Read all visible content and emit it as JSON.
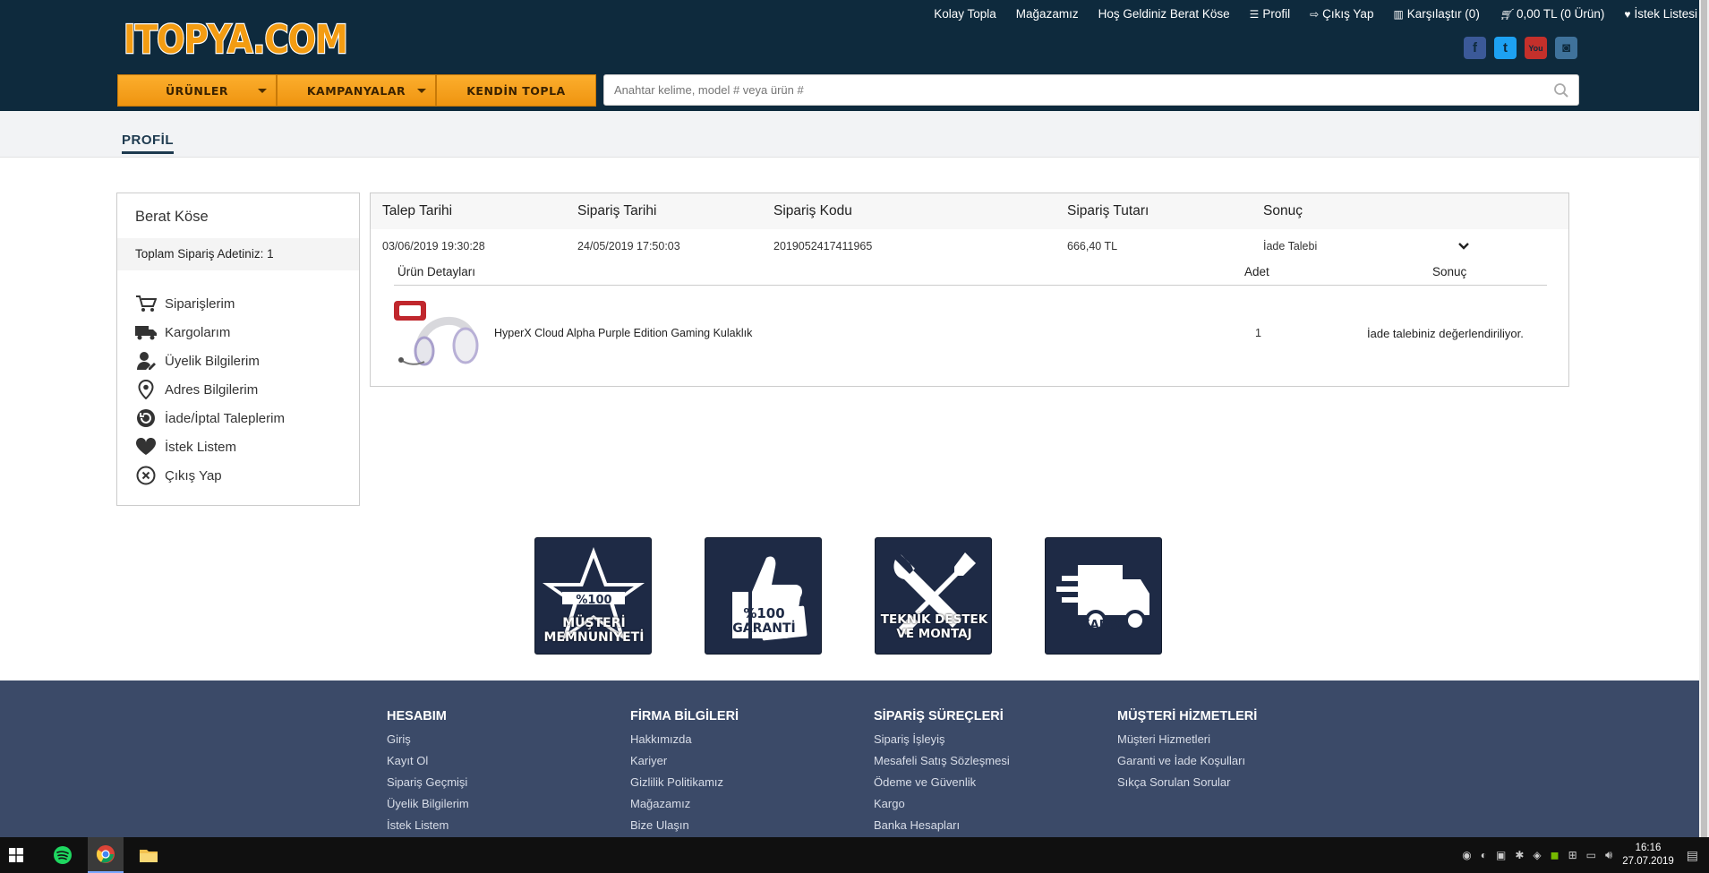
{
  "header": {
    "logo_text": "ITOPYA.COM",
    "top_links": [
      {
        "label": "Kolay Topla",
        "icon": ""
      },
      {
        "label": "Mağazamız",
        "icon": ""
      },
      {
        "label": "Hoş Geldiniz Berat Köse",
        "icon": ""
      },
      {
        "label": "Profil",
        "icon": "list-icon"
      },
      {
        "label": "Çıkış Yap",
        "icon": "logout-icon"
      },
      {
        "label": "Karşılaştır (0)",
        "icon": "bar-chart-icon"
      },
      {
        "label": "0,00 TL (0 Ürün)",
        "icon": "cart-icon"
      },
      {
        "label": "İstek Listesi",
        "icon": "heart-icon"
      }
    ],
    "social": [
      "facebook-icon",
      "twitter-icon",
      "youtube-icon",
      "instagram-icon"
    ],
    "nav": [
      {
        "label": "ÜRÜNLER",
        "dropdown": true
      },
      {
        "label": "KAMPANYALAR",
        "dropdown": true
      },
      {
        "label": "KENDİN TOPLA",
        "dropdown": false
      }
    ],
    "search_placeholder": "Anahtar kelime, model # veya ürün #"
  },
  "page_tab": "PROFİL",
  "sidebar": {
    "user_name": "Berat Köse",
    "order_count": "Toplam Sipariş Adetiniz: 1",
    "menu": [
      {
        "label": "Siparişlerim",
        "icon": "cart-icon"
      },
      {
        "label": "Kargolarım",
        "icon": "truck-icon"
      },
      {
        "label": "Üyelik Bilgilerim",
        "icon": "user-icon"
      },
      {
        "label": "Adres Bilgilerim",
        "icon": "map-pin-icon"
      },
      {
        "label": "İade/İptal Taleplerim",
        "icon": "refresh-icon"
      },
      {
        "label": "İstek Listem",
        "icon": "heart-icon"
      },
      {
        "label": "Çıkış Yap",
        "icon": "close-circle-icon"
      }
    ]
  },
  "orders": {
    "headers": {
      "request_date": "Talep Tarihi",
      "order_date": "Sipariş Tarihi",
      "order_code": "Sipariş Kodu",
      "order_total": "Sipariş Tutarı",
      "result": "Sonuç"
    },
    "row": {
      "request_date": "03/06/2019 19:30:28",
      "order_date": "24/05/2019 17:50:03",
      "order_code": "2019052417411965",
      "order_total": "666,40 TL",
      "result": "İade Talebi"
    },
    "detail_headers": {
      "product": "Ürün Detayları",
      "qty": "Adet",
      "result": "Sonuç"
    },
    "item": {
      "name": "HyperX Cloud Alpha Purple Edition Gaming Kulaklık",
      "qty": "1",
      "result": "İade talebiniz değerlendiriliyor."
    }
  },
  "badges": [
    {
      "line1": "%100",
      "line2": "MÜŞTERİ",
      "line3": "MEMNUNİYETİ"
    },
    {
      "line1": "%100",
      "line2": "GARANTİ",
      "line3": ""
    },
    {
      "line1": "TEKNİK DESTEK",
      "line2": "VE MONTAJ",
      "line3": ""
    },
    {
      "line1": "KARGO",
      "line2": "",
      "line3": ""
    }
  ],
  "footer": {
    "columns": [
      {
        "title": "HESABIM",
        "links": [
          "Giriş",
          "Kayıt Ol",
          "Sipariş Geçmişi",
          "Üyelik Bilgilerim",
          "İstek Listem"
        ]
      },
      {
        "title": "FİRMA BİLGİLERİ",
        "links": [
          "Hakkımızda",
          "Kariyer",
          "Gizlilik Politikamız",
          "Mağazamız",
          "Bize Ulaşın"
        ]
      },
      {
        "title": "SİPARİŞ SÜREÇLERİ",
        "links": [
          "Sipariş İşleyiş",
          "Mesafeli Satış Sözleşmesi",
          "Ödeme ve Güvenlik",
          "Kargo",
          "Banka Hesapları"
        ]
      },
      {
        "title": "MÜŞTERİ HİZMETLERİ",
        "links": [
          "Müşteri Hizmetleri",
          "Garanti ve İade Koşulları",
          "Sıkça Sorulan Sorular"
        ]
      }
    ]
  },
  "taskbar": {
    "apps": [
      "windows-start-icon",
      "spotify-icon",
      "chrome-icon",
      "file-explorer-icon"
    ],
    "time": "16:16",
    "date": "27.07.2019"
  },
  "colors": {
    "header_bg": "#0e2a3d",
    "accent_orange": "#f39c12",
    "footer_bg": "#3b4a68",
    "badge_bg": "#1e2a45"
  }
}
